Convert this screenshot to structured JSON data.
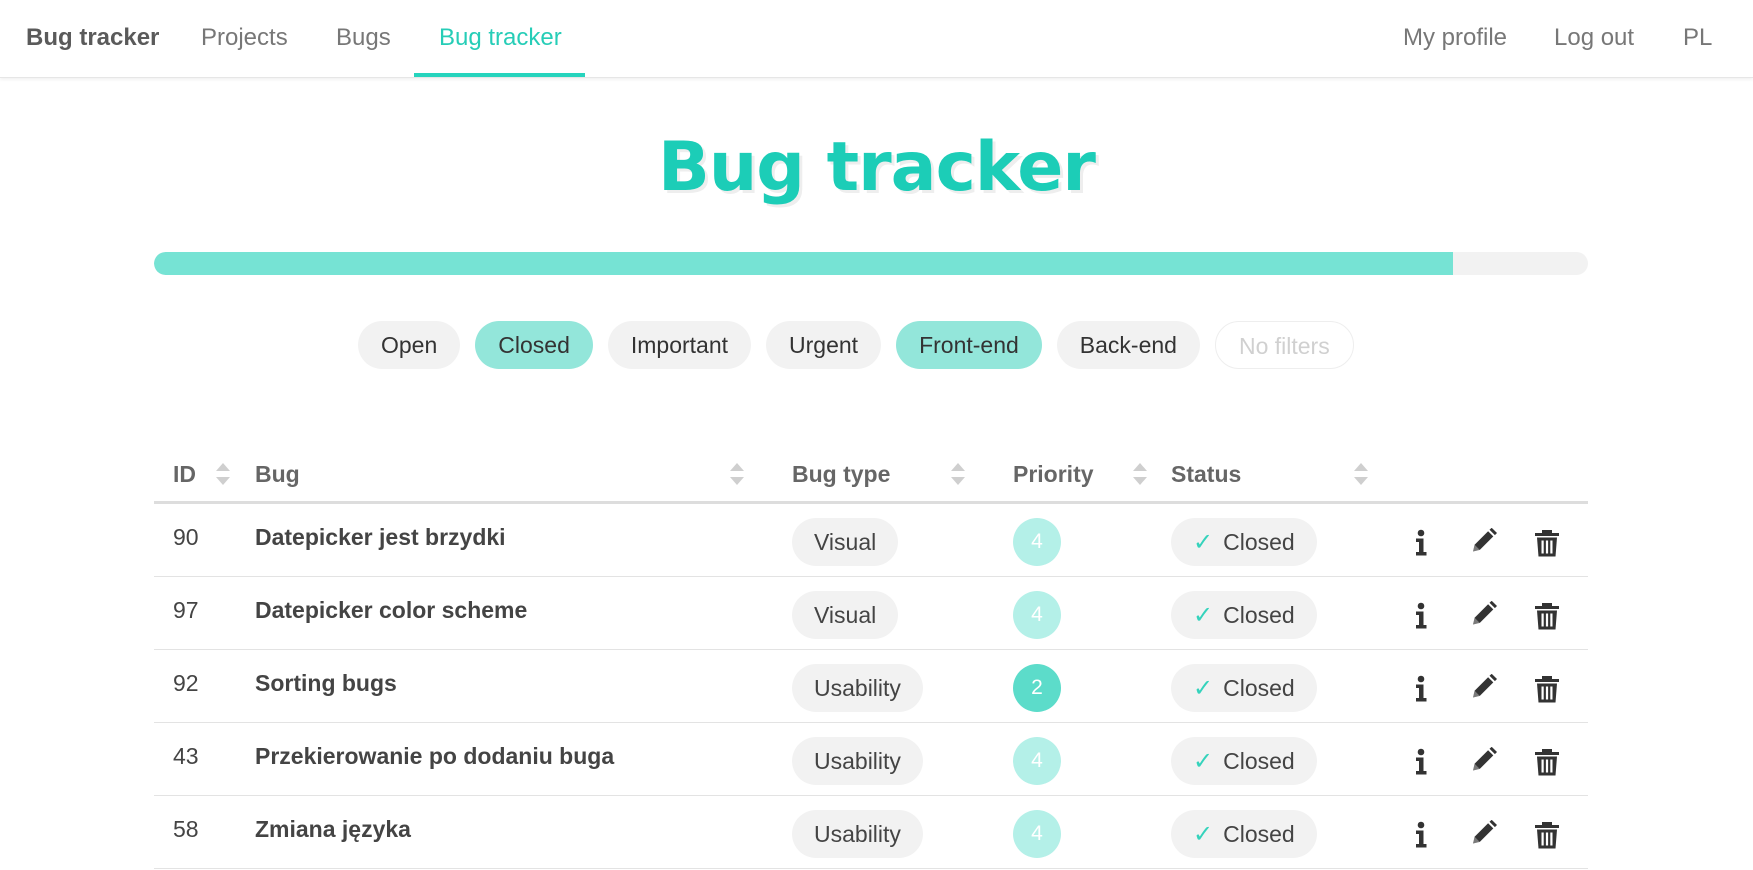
{
  "navbar": {
    "brand": "Bug tracker",
    "links": [
      "Projects",
      "Bugs",
      "Bug tracker"
    ],
    "right_links": [
      "My profile",
      "Log out",
      "PL"
    ]
  },
  "page": {
    "title": "Bug tracker",
    "progress_fraction": 0.906
  },
  "filters": [
    {
      "label": "Open",
      "state": "inactive"
    },
    {
      "label": "Closed",
      "state": "active"
    },
    {
      "label": "Important",
      "state": "inactive"
    },
    {
      "label": "Urgent",
      "state": "inactive"
    },
    {
      "label": "Front-end",
      "state": "active"
    },
    {
      "label": "Back-end",
      "state": "inactive"
    },
    {
      "label": "No filters",
      "state": "disabled"
    }
  ],
  "table": {
    "columns": [
      "ID",
      "Bug",
      "Bug type",
      "Priority",
      "Status"
    ],
    "rows": [
      {
        "id": "90",
        "bug": "Datepicker jest brzydki",
        "type": "Visual",
        "priority": "4",
        "status": "Closed",
        "priority_color": "#b4f0e8"
      },
      {
        "id": "97",
        "bug": "Datepicker color scheme",
        "type": "Visual",
        "priority": "4",
        "status": "Closed",
        "priority_color": "#b4f0e8"
      },
      {
        "id": "92",
        "bug": "Sorting bugs",
        "type": "Usability",
        "priority": "2",
        "status": "Closed",
        "priority_color": "#5cdcca"
      },
      {
        "id": "43",
        "bug": "Przekierowanie po dodaniu buga",
        "type": "Usability",
        "priority": "4",
        "status": "Closed",
        "priority_color": "#b4f0e8"
      },
      {
        "id": "58",
        "bug": "Zmiana języka",
        "type": "Usability",
        "priority": "4",
        "status": "Closed",
        "priority_color": "#b4f0e8"
      }
    ],
    "status_icon": "check-icon",
    "action_icons": [
      "info-icon",
      "pencil-icon",
      "trash-icon"
    ]
  },
  "colors": {
    "accent": "#1ccdb7",
    "active_chip": "#93e6da",
    "progress": "#76e3d4"
  }
}
